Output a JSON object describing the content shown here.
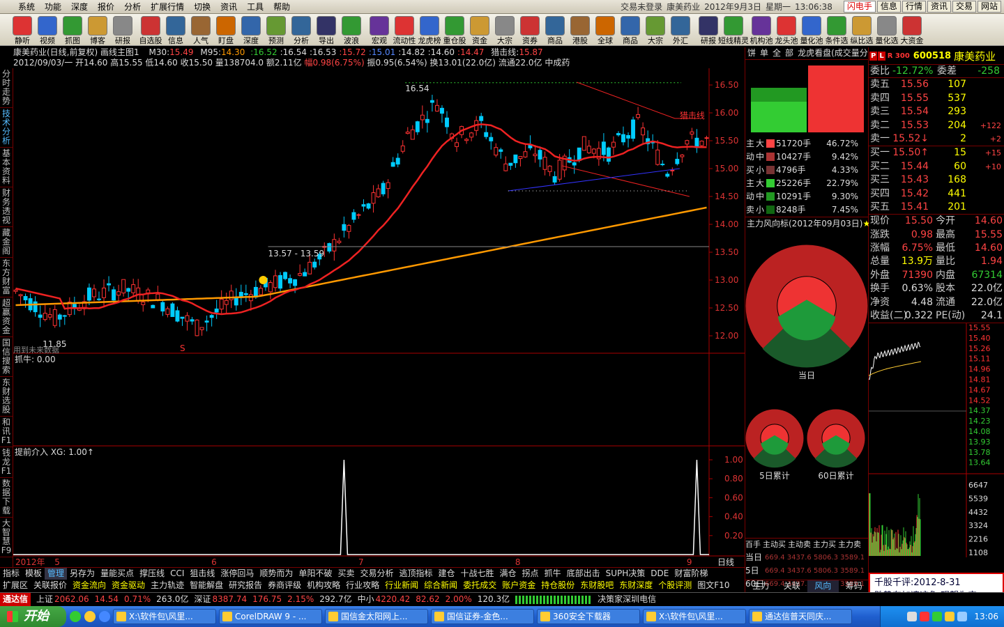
{
  "menu": {
    "items": [
      "系统",
      "功能",
      "深度",
      "报价",
      "分析",
      "扩展行情",
      "切换",
      "资讯",
      "工具",
      "帮助"
    ],
    "title_parts": [
      "交易未登录",
      "康美药业",
      "2012年9月3日",
      "星期一",
      "13:06:38"
    ],
    "right_buttons": [
      "闪电手",
      "信息",
      "行情",
      "资讯",
      "交易",
      "网站"
    ]
  },
  "toolbar": {
    "group1": [
      "静听",
      "视频",
      "抓图",
      "博客",
      "研报"
    ],
    "group2": [
      "自选股",
      "信息",
      "人气",
      "盯盘",
      "深度",
      "预测",
      "分析",
      "导出",
      "波浪"
    ],
    "group3": [
      "宏观",
      "流动性",
      "龙虎榜",
      "重仓股",
      "资金",
      "大宗",
      "资券",
      "商品",
      "港股",
      "全球",
      "商品",
      "大宗",
      "外汇"
    ],
    "group4": [
      "研报",
      "短线精灵"
    ],
    "group5": [
      "机构池",
      "龙头池",
      "量化池",
      "条件选",
      "纵比选",
      "量化选",
      "大资金"
    ]
  },
  "leftnav": [
    "分时走势",
    "技术分析",
    "基本资料",
    "财务透视",
    "藏金阁",
    "东方财富",
    "超赢资金",
    "国信搜索",
    "东财选股",
    "和讯F1",
    "钱龙F1",
    "数据下载",
    "大智慧F9"
  ],
  "leftnav_active": 1,
  "chart_header": {
    "line1": {
      "name": "康美药业(日线,前复权)",
      "template": "画线主图1",
      "m30_label": "M30:",
      "m30": "15.49",
      "m95_label": "M95:",
      "m95": "14.30",
      "extra": [
        ":16.52",
        ":16.54",
        ":16.53",
        ":15.72",
        ":15.01",
        ":14.82",
        ":14.60",
        ":14.47"
      ],
      "hunt_label": "猎击线:",
      "hunt": "15.87"
    },
    "line2": {
      "date": "2012/09/03/一",
      "open": "开14.60",
      "high": "高15.55",
      "low": "低14.60",
      "close": "收15.50",
      "vol": "量138704.0",
      "amt": "额2.11亿",
      "chg": "幅0.98(6.75%)",
      "amp": "振0.95(6.54%)",
      "turn": "换13.01(22.0亿)",
      "cap": "流通22.0亿",
      "sector": "中成药"
    }
  },
  "chart_data": {
    "type": "candlestick",
    "ylim": [
      11.6,
      16.7
    ],
    "y_ticks": [
      "16.50",
      "16.00",
      "15.50",
      "15.00",
      "14.50",
      "14.00",
      "13.50",
      "13.00",
      "12.50",
      "12.00"
    ],
    "x_ticks": [
      "2012年",
      "5",
      "6",
      "7",
      "8",
      "9"
    ],
    "period_label": "日线",
    "annotations": {
      "high_label": "16.54",
      "low_label": "11.85",
      "box_label": "13.57 - 13.59",
      "hunt_line_label": "猎击线",
      "future_label": "用到未来数据",
      "s_marker": "S"
    },
    "indicator1": {
      "title": "抓牛",
      "value_text": "抓牛: 0.00"
    },
    "indicator2": {
      "title": "提前介入",
      "value_text": "XG: 1.00",
      "y_ticks": [
        "1.00",
        "0.80",
        "0.60",
        "0.40",
        "0.20"
      ],
      "spikes": [
        {
          "bar": 67,
          "value": 1.0
        },
        {
          "bar": 139,
          "value": 1.0
        }
      ]
    },
    "ma": {
      "m30_start": 15.3,
      "m30_end": 15.49,
      "m95_start": 12.55,
      "m95_end": 14.3
    },
    "candles_anchor": [
      [
        0,
        12.8
      ],
      [
        8,
        12.3
      ],
      [
        15,
        12.7
      ],
      [
        22,
        12.85
      ],
      [
        30,
        12.6
      ],
      [
        37,
        12.15
      ],
      [
        45,
        12.7
      ],
      [
        52,
        12.9
      ],
      [
        58,
        13.1
      ],
      [
        63,
        13.45
      ],
      [
        70,
        14.15
      ],
      [
        75,
        14.6
      ],
      [
        80,
        15.6
      ],
      [
        86,
        16.2
      ],
      [
        90,
        15.55
      ],
      [
        95,
        15.8
      ],
      [
        100,
        15.1
      ],
      [
        106,
        15.3
      ],
      [
        110,
        14.9
      ],
      [
        116,
        15.4
      ],
      [
        121,
        15.3
      ],
      [
        127,
        15.8
      ],
      [
        133,
        14.95
      ],
      [
        137,
        15.5
      ],
      [
        141,
        15.5
      ]
    ]
  },
  "bottom_tabs1": [
    "指标",
    "模板",
    "管理",
    "另存为",
    "量能买点",
    "撑压线",
    "CCI",
    "狙击线",
    "涨停回马",
    "顺势而为",
    "单阳不破",
    "买卖",
    "交易分析",
    "逃顶指标",
    "建仓",
    "十战七胜",
    "满仓",
    "拐点",
    "抓牛",
    "底部出击",
    "SUPH决策",
    "DDE",
    "财富阶梯"
  ],
  "bottom_tabs1_sel": 2,
  "bottom_tabs2": [
    "扩展区",
    "关联报价",
    "资金流向",
    "资金驱动",
    "主力轨迹",
    "智能解盘",
    "研究报告",
    "券商评级",
    "机构攻略",
    "行业攻略",
    "行业新闻",
    "综合新闻",
    "委托成交",
    "账户资金",
    "持仓股份",
    "东财股吧",
    "东财深度",
    "个股评测",
    "图文F10"
  ],
  "status": {
    "brand": "通达信",
    "sh_label": "上证",
    "sh": "2062.06",
    "sh_chg": "14.54",
    "sh_pct": "0.71%",
    "sh_amt": "263.0亿",
    "sz_label": "深证",
    "sz": "8387.74",
    "sz_chg": "176.75",
    "sz_pct": "2.15%",
    "sz_amt": "292.7亿",
    "zx_label": "中小",
    "zx": "4220.42",
    "zx_chg": "82.62",
    "zx_pct": "2.00%",
    "zx_amt": "120.3亿",
    "server": "决策家深圳电信"
  },
  "taskbar": {
    "start": "开始",
    "tasks": [
      "X:\\软件包\\风里...",
      "CorelDRAW 9 - ...",
      "国信金太阳网上...",
      "国信证券-金色...",
      "360安全下载器",
      "X:\\软件包\\风里...",
      "通达信普天同庆..."
    ],
    "clock": "13:06"
  },
  "mid": {
    "tabs": [
      "饼",
      "单",
      "全",
      "部",
      "龙虎看盘(成交量分"
    ],
    "flows": [
      {
        "a": "主",
        "b": "大",
        "color": "#f44",
        "v": "51720手",
        "p": "46.72%"
      },
      {
        "a": "动",
        "b": "中",
        "color": "#a33",
        "v": "10427手",
        "p": "9.42%"
      },
      {
        "a": "买",
        "b": "小",
        "color": "#733",
        "v": "4796手",
        "p": "4.33%"
      },
      {
        "a": "主",
        "b": "大",
        "color": "#3c3",
        "v": "25226手",
        "p": "22.79%"
      },
      {
        "a": "动",
        "b": "中",
        "color": "#292",
        "v": "10291手",
        "p": "9.30%"
      },
      {
        "a": "卖",
        "b": "小",
        "color": "#161",
        "v": "8248手",
        "p": "7.45%"
      }
    ],
    "dir_title": "主力风向标(2012年09月03日)",
    "pie_labels": [
      "当日",
      "5日累计",
      "60日累计"
    ],
    "table_head": [
      "百手",
      "主动买",
      "主动卖",
      "主力买",
      "主力卖"
    ],
    "table_rows": [
      {
        "label": "当日",
        "vals": "669.4 3437.6 5806.3 3589.1"
      },
      {
        "label": "5日",
        "vals": "669.4 3437.6 5806.3 3589.1"
      },
      {
        "label": "60日",
        "vals": "669.4 3437.6 5806.3 3589.1"
      }
    ],
    "bottom_tabs": [
      "主力",
      "关联",
      "风向",
      "筹码"
    ]
  },
  "quote": {
    "code": "600518",
    "name": "康美药业",
    "badges": [
      "P",
      "L",
      "R 300"
    ],
    "webi": "委比",
    "webi_v": "-12.72%",
    "weicha": "委差",
    "weicha_v": "-258",
    "asks": [
      {
        "l": "卖五",
        "p": "15.56",
        "v": "107",
        "c": ""
      },
      {
        "l": "卖四",
        "p": "15.55",
        "v": "537",
        "c": ""
      },
      {
        "l": "卖三",
        "p": "15.54",
        "v": "293",
        "c": ""
      },
      {
        "l": "卖二",
        "p": "15.53",
        "v": "204",
        "c": "+122"
      },
      {
        "l": "卖一",
        "p": "15.52↓",
        "v": "2",
        "c": "+2"
      }
    ],
    "bids": [
      {
        "l": "买一",
        "p": "15.50↑",
        "v": "15",
        "c": "+15"
      },
      {
        "l": "买二",
        "p": "15.44",
        "v": "60",
        "c": "+10"
      },
      {
        "l": "买三",
        "p": "15.43",
        "v": "168",
        "c": ""
      },
      {
        "l": "买四",
        "p": "15.42",
        "v": "441",
        "c": ""
      },
      {
        "l": "买五",
        "p": "15.41",
        "v": "201",
        "c": ""
      }
    ],
    "stats": [
      {
        "l1": "现价",
        "v1": "15.50",
        "c1": "#f44",
        "l2": "今开",
        "v2": "14.60",
        "c2": "#f44"
      },
      {
        "l1": "涨跌",
        "v1": "0.98",
        "c1": "#f44",
        "l2": "最高",
        "v2": "15.55",
        "c2": "#f44"
      },
      {
        "l1": "涨幅",
        "v1": "6.75%",
        "c1": "#f44",
        "l2": "最低",
        "v2": "14.60",
        "c2": "#f44"
      },
      {
        "l1": "总量",
        "v1": "13.9万",
        "c1": "#ff0",
        "l2": "量比",
        "v2": "1.94",
        "c2": "#f44"
      },
      {
        "l1": "外盘",
        "v1": "71390",
        "c1": "#f44",
        "l2": "内盘",
        "v2": "67314",
        "c2": "#3c3"
      },
      {
        "l1": "换手",
        "v1": "0.63%",
        "c1": "#ddd",
        "l2": "股本",
        "v2": "22.0亿",
        "c2": "#ddd"
      },
      {
        "l1": "净资",
        "v1": "4.48",
        "c1": "#ddd",
        "l2": "流通",
        "v2": "22.0亿",
        "c2": "#ddd"
      },
      {
        "l1": "收益(二)",
        "v1": "0.322",
        "c1": "#ddd",
        "l2": "PE(动)",
        "v2": "24.1",
        "c2": "#ddd"
      }
    ],
    "mini_ticks": [
      "15.55",
      "15.40",
      "15.26",
      "15.11",
      "14.96",
      "14.81",
      "14.67",
      "14.52",
      "14.37",
      "14.23",
      "14.08",
      "13.93",
      "13.78",
      "13.64"
    ],
    "vol_ticks": [
      "6647",
      "5539",
      "4432",
      "3324",
      "2216",
      "1108"
    ]
  },
  "comment": {
    "line1": "千股千评:2012-8-31",
    "line2": "跌势有加速迹象,观望为宜"
  }
}
